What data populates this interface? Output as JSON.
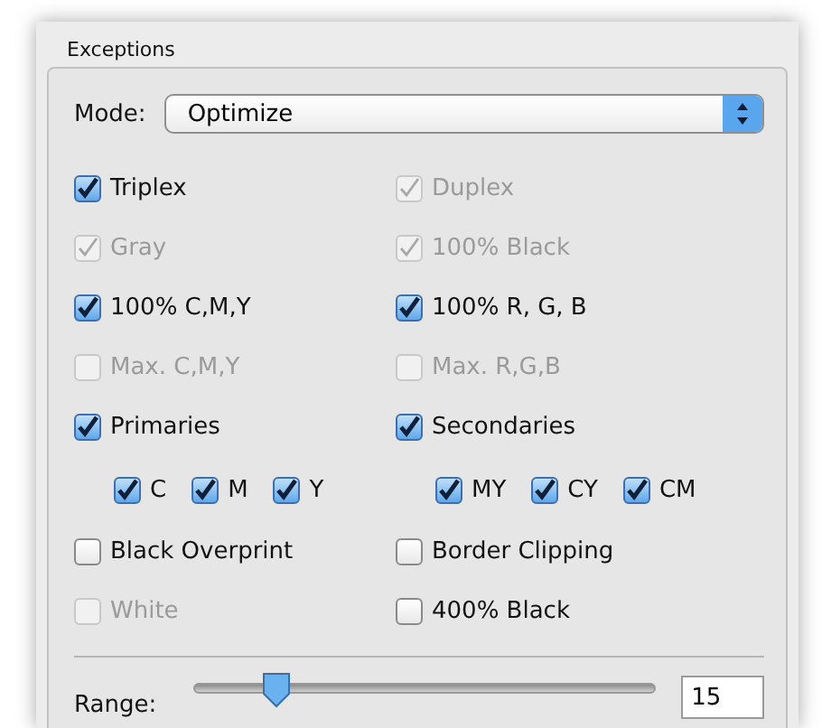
{
  "panel": {
    "title": "Exceptions"
  },
  "mode": {
    "label": "Mode:",
    "value": "Optimize"
  },
  "rows": [
    {
      "left": {
        "label": "Triplex",
        "checked": true,
        "disabled": false
      },
      "right": {
        "label": "Duplex",
        "checked": true,
        "disabled": true
      }
    },
    {
      "left": {
        "label": "Gray",
        "checked": true,
        "disabled": true
      },
      "right": {
        "label": "100% Black",
        "checked": true,
        "disabled": true
      }
    },
    {
      "left": {
        "label": "100% C,M,Y",
        "checked": true,
        "disabled": false
      },
      "right": {
        "label": "100% R, G, B",
        "checked": true,
        "disabled": false
      }
    },
    {
      "left": {
        "label": "Max. C,M,Y",
        "checked": false,
        "disabled": true
      },
      "right": {
        "label": "Max. R,G,B",
        "checked": false,
        "disabled": true
      }
    },
    {
      "left": {
        "label": "Primaries",
        "checked": true,
        "disabled": false
      },
      "right": {
        "label": "Secondaries",
        "checked": true,
        "disabled": false
      }
    }
  ],
  "sub": {
    "left": [
      {
        "label": "C",
        "checked": true
      },
      {
        "label": "M",
        "checked": true
      },
      {
        "label": "Y",
        "checked": true
      }
    ],
    "right": [
      {
        "label": "MY",
        "checked": true
      },
      {
        "label": "CY",
        "checked": true
      },
      {
        "label": "CM",
        "checked": true
      }
    ]
  },
  "rows2": [
    {
      "left": {
        "label": "Black Overprint",
        "checked": false,
        "disabled": false
      },
      "right": {
        "label": "Border Clipping",
        "checked": false,
        "disabled": false
      }
    },
    {
      "left": {
        "label": "White",
        "checked": false,
        "disabled": true
      },
      "right": {
        "label": "400% Black",
        "checked": false,
        "disabled": false
      }
    }
  ],
  "range": {
    "label": "Range:",
    "level": 0.18,
    "value": "15"
  }
}
